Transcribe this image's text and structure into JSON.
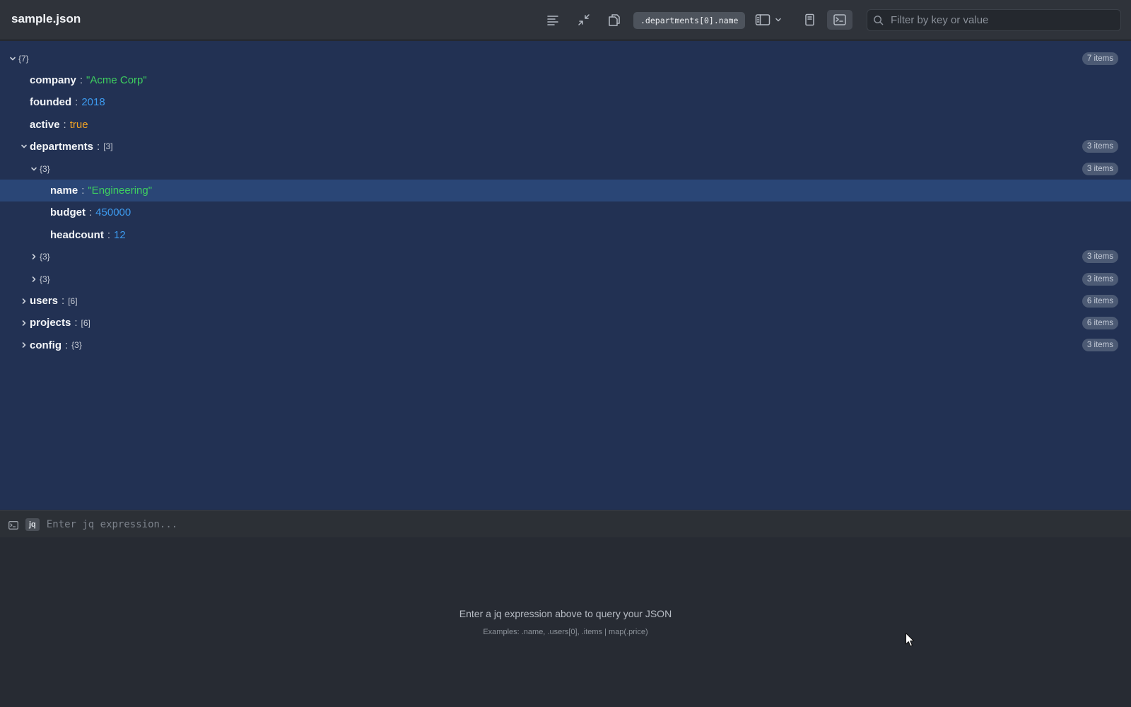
{
  "window": {
    "title": "sample.json"
  },
  "toolbar": {
    "path": ".departments[0].name",
    "search_placeholder": "Filter by key or value"
  },
  "tree": {
    "rows": [
      {
        "kind": "container",
        "expanded": true,
        "depth": 0,
        "key": "",
        "bracket": "{7}",
        "badge": "7 items"
      },
      {
        "kind": "leaf",
        "depth": 1,
        "key": "company",
        "value": "\"Acme Corp\"",
        "type": "string"
      },
      {
        "kind": "leaf",
        "depth": 1,
        "key": "founded",
        "value": "2018",
        "type": "number"
      },
      {
        "kind": "leaf",
        "depth": 1,
        "key": "active",
        "value": "true",
        "type": "boolean"
      },
      {
        "kind": "container",
        "expanded": true,
        "depth": 1,
        "key": "departments",
        "bracket": "[3]",
        "badge": "3 items"
      },
      {
        "kind": "container",
        "expanded": true,
        "depth": 2,
        "key": "",
        "bracket": "{3}",
        "badge": "3 items"
      },
      {
        "kind": "leaf",
        "depth": 3,
        "key": "name",
        "value": "\"Engineering\"",
        "type": "string",
        "selected": true
      },
      {
        "kind": "leaf",
        "depth": 3,
        "key": "budget",
        "value": "450000",
        "type": "number"
      },
      {
        "kind": "leaf",
        "depth": 3,
        "key": "headcount",
        "value": "12",
        "type": "number"
      },
      {
        "kind": "container",
        "expanded": false,
        "depth": 2,
        "key": "",
        "bracket": "{3}",
        "badge": "3 items"
      },
      {
        "kind": "container",
        "expanded": false,
        "depth": 2,
        "key": "",
        "bracket": "{3}",
        "badge": "3 items"
      },
      {
        "kind": "container",
        "expanded": false,
        "depth": 1,
        "key": "users",
        "bracket": "[6]",
        "badge": "6 items"
      },
      {
        "kind": "container",
        "expanded": false,
        "depth": 1,
        "key": "projects",
        "bracket": "[6]",
        "badge": "6 items"
      },
      {
        "kind": "container",
        "expanded": false,
        "depth": 1,
        "key": "config",
        "bracket": "{3}",
        "badge": "3 items"
      }
    ]
  },
  "query": {
    "tag": "jq",
    "placeholder": "Enter jq expression...",
    "hint": "Enter a jq expression above to query your JSON",
    "examples": "Examples: .name, .users[0], .items | map(.price)"
  },
  "colors": {
    "string": "#3ecf5f",
    "number": "#3d9bf0",
    "boolean": "#f5a524",
    "tree_bg": "#223153",
    "selected_bg": "#2a4676"
  },
  "icons": [
    "format-icon",
    "collapse-icon",
    "copy-icon",
    "layout-icon",
    "chevron-down-icon",
    "document-icon",
    "terminal-icon",
    "search-icon"
  ]
}
